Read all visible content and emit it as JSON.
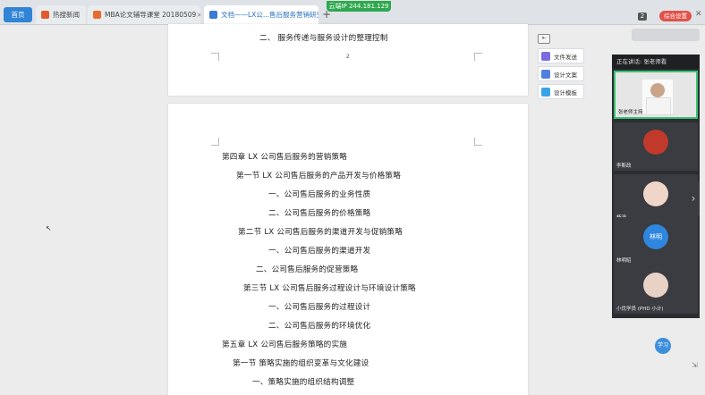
{
  "tabs": [
    {
      "label": "首页"
    },
    {
      "label": "热搜新闻",
      "color": "#e05a2b"
    },
    {
      "label": "MBA论文辅导课堂 20180509",
      "color": "#e86b2e"
    },
    {
      "label": "文档——LX公...售后服务营销研究",
      "color": "#3a7bd5"
    }
  ],
  "toolbar": {
    "ip": "云端IP 244.181.129",
    "count": "2",
    "user": "综合设置",
    "new_tab": "+"
  },
  "document": {
    "page1_line": "二、   服务传递与服务设计的整理控制",
    "page1_num": "2",
    "toc": [
      {
        "text": "第四章 LX 公司售后服务的营销策略"
      },
      {
        "text": "第一节   LX 公司售后服务的产品开发与价格策略"
      },
      {
        "text": "一、公司售后服务的业务性质"
      },
      {
        "text": "二、公司售后服务的价格策略"
      },
      {
        "text": "第二节   LX 公司售后服务的渠道开发与促销策略"
      },
      {
        "text": "一、公司售后服务的渠道开发"
      },
      {
        "text": "二、公司售后服务的促营策略"
      },
      {
        "text": "第三节   LX 公司售后服务过程设计与环境设计策略"
      },
      {
        "text": "一、公司售后服务的过程设计"
      },
      {
        "text": "二、公司售后服务的环境优化"
      },
      {
        "text": "第五章 LX 公司售后服务策略的实施"
      },
      {
        "text": "第一节  策略实施的组织变革与文化建设"
      },
      {
        "text": "一、策略实施的组织结构调整"
      }
    ]
  },
  "side_buttons": [
    {
      "label": "文件发送",
      "color": "#7b6be0"
    },
    {
      "label": "设计文案",
      "color": "#4f7fe0"
    },
    {
      "label": "设计模板",
      "color": "#3aa3e8"
    }
  ],
  "video_panel": {
    "header": "正在讲话: 张老师看",
    "participants": [
      {
        "label": "张老师主持",
        "avatar_text": ""
      },
      {
        "label": "李斯政",
        "avatar_text": ""
      },
      {
        "label": "杨涵",
        "avatar_text": ""
      },
      {
        "label": "林明昭",
        "avatar_text": "林明"
      },
      {
        "label": "小优学员 (PHD 小计)",
        "avatar_text": ""
      }
    ],
    "arrow": "›"
  },
  "float_button": "学习",
  "colors": {
    "accent": "#2f84d6",
    "speaker_border": "#38c172",
    "panel_bg": "#2b2d31"
  }
}
